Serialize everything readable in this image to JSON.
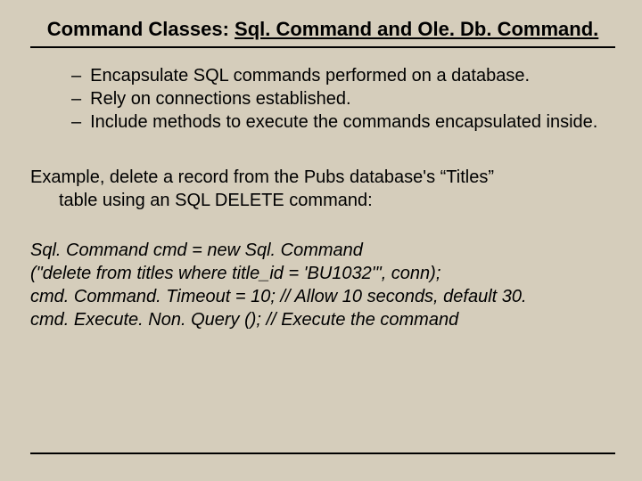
{
  "title": {
    "lead": "Command Classes: ",
    "underlined": "Sql. Command and Ole. Db. Command."
  },
  "bullets": [
    "Encapsulate SQL commands performed on a database.",
    "Rely on connections established.",
    "Include methods to execute the commands encapsulated inside."
  ],
  "example": {
    "line1": "Example, delete a record from the Pubs database's “Titles”",
    "line2": "table using an SQL DELETE command:"
  },
  "code": {
    "l1": "Sql. Command  cmd = new Sql. Command",
    "l2": " (\"delete from titles where title_id = 'BU1032'\", conn);",
    "l3": "cmd. Command. Timeout = 10; // Allow 10 seconds, default 30.",
    "l4": "cmd. Execute. Non. Query (); // Execute the command"
  }
}
